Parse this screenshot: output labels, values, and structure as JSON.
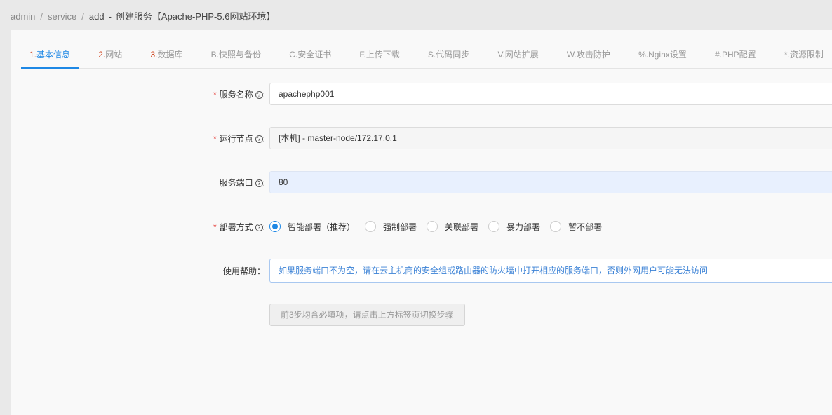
{
  "breadcrumb": {
    "items": [
      "admin",
      "service",
      "add"
    ],
    "title": "创建服务【Apache-PHP-5.6网站环境】",
    "dash": "-",
    "sep": "/"
  },
  "tabs": [
    {
      "num": "1.",
      "label": "基本信息"
    },
    {
      "num": "2.",
      "label": "网站"
    },
    {
      "num": "3.",
      "label": "数据库"
    },
    {
      "num": "",
      "label": "B.快照与备份"
    },
    {
      "num": "",
      "label": "C.安全证书"
    },
    {
      "num": "",
      "label": "F.上传下载"
    },
    {
      "num": "",
      "label": "S.代码同步"
    },
    {
      "num": "",
      "label": "V.网站扩展"
    },
    {
      "num": "",
      "label": "W.攻击防护"
    },
    {
      "num": "",
      "label": "%.Nginx设置"
    },
    {
      "num": "",
      "label": "#.PHP配置"
    },
    {
      "num": "",
      "label": "*.资源限制"
    }
  ],
  "form": {
    "required_mark": "*",
    "help_mark": "?",
    "service_name": {
      "label": "服务名称",
      "value": "apachephp001"
    },
    "node": {
      "label": "运行节点",
      "value": "[本机] - master-node/172.17.0.1"
    },
    "port": {
      "label": "服务端口",
      "value": "80"
    },
    "deploy": {
      "label": "部署方式",
      "options": [
        "智能部署（推荐）",
        "强制部署",
        "关联部署",
        "暴力部署",
        "暂不部署"
      ],
      "selected": 0
    },
    "help": {
      "label": "使用帮助：",
      "text": "如果服务端口不为空，请在云主机商的安全组或路由器的防火墙中打开相应的服务端口，否则外网用户可能无法访问"
    },
    "submit_label": "前3步均含必填项，请点击上方标签页切换步骤"
  },
  "colors": {
    "accent": "#1e88e5",
    "required": "#e53935",
    "step_num": "#d0421b"
  }
}
